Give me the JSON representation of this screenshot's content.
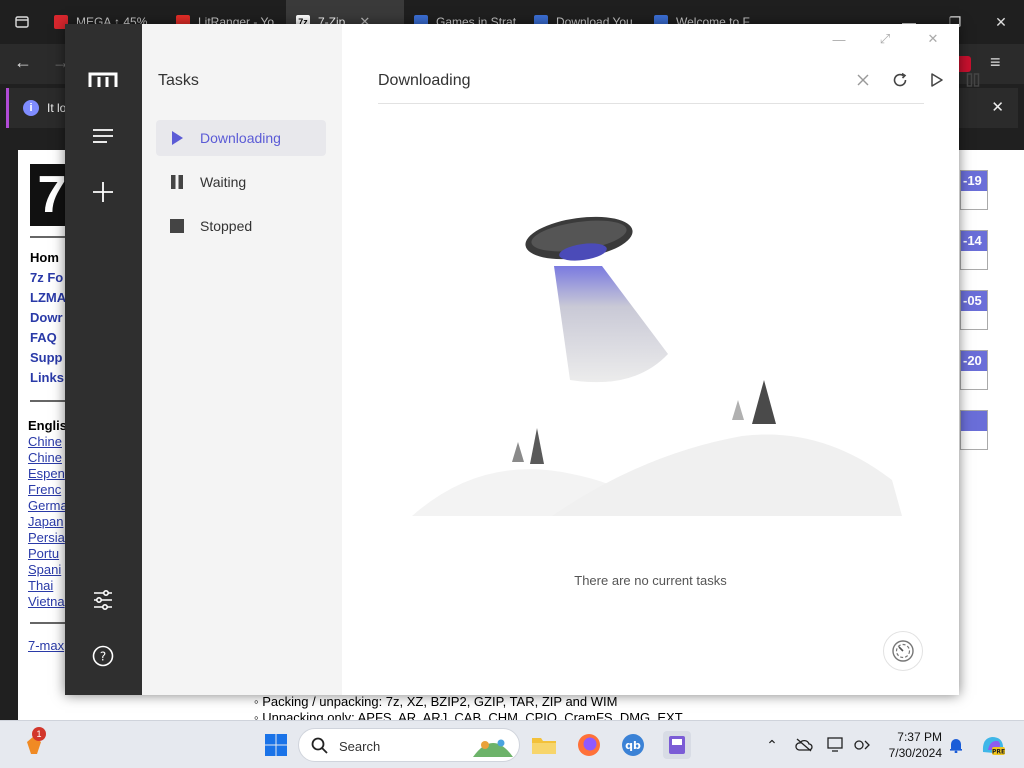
{
  "browser": {
    "tabs": [
      {
        "label": "MEGA ↑ 45%",
        "fav_color": "#d9272e"
      },
      {
        "label": "LitRanger - Yo",
        "fav_color": "#e52d27"
      },
      {
        "label": "7-Zip",
        "fav_color": "#ffffff",
        "active": true
      },
      {
        "label": "Games in Strat",
        "fav_color": "#3b6fd6"
      },
      {
        "label": "Download You",
        "fav_color": "#3b6fd6"
      },
      {
        "label": "Welcome to F",
        "fav_color": "#3b6fd6"
      }
    ],
    "info_text": "It lo",
    "info_close": "✕"
  },
  "webpage": {
    "logo": "7",
    "nav": [
      "Hom",
      "7z Fo",
      "LZMA",
      "Dowr",
      "FAQ",
      "Supp",
      "Links"
    ],
    "langs": [
      "Englis",
      "Chine",
      "Chine",
      "Espen",
      "Frenc",
      "Germa",
      "Japan",
      "Persia",
      "Portu",
      "Spani",
      "Thai",
      "Vietna"
    ],
    "max_link": "7-max",
    "dates": [
      "-19",
      "-14",
      "-05",
      "-20",
      ""
    ],
    "bullets": [
      "◦ Packing / unpacking: 7z, XZ, BZIP2, GZIP, TAR, ZIP and WIM",
      "◦ Unpacking only: APFS, AR, ARJ, CAB, CHM, CPIO, CramFS, DMG, EXT"
    ]
  },
  "app": {
    "side_title": "Tasks",
    "side_items": [
      {
        "label": "Downloading",
        "icon": "play-icon",
        "active": true
      },
      {
        "label": "Waiting",
        "icon": "pause-icon"
      },
      {
        "label": "Stopped",
        "icon": "stop-icon"
      }
    ],
    "main_title": "Downloading",
    "empty_text": "There are no current tasks",
    "accent_color": "#5b5bd6"
  },
  "taskbar": {
    "search_label": "Search",
    "notification_count": "1",
    "time": "7:37 PM",
    "date": "7/30/2024"
  }
}
